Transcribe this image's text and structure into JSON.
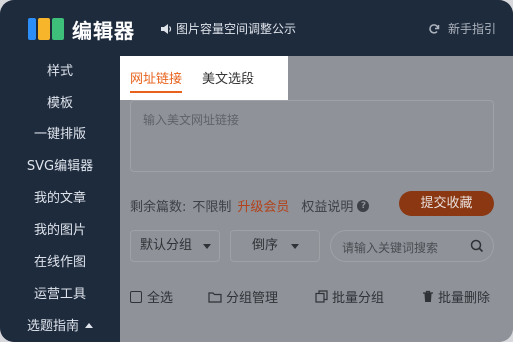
{
  "header": {
    "logo_text": "编辑器",
    "notice": "图片容量空间调整公示",
    "guide": "新手指引"
  },
  "sidebar": {
    "items": [
      {
        "label": "样式"
      },
      {
        "label": "模板"
      },
      {
        "label": "一键排版"
      },
      {
        "label": "SVG编辑器"
      },
      {
        "label": "我的文章"
      },
      {
        "label": "我的图片"
      },
      {
        "label": "在线作图"
      },
      {
        "label": "运营工具"
      },
      {
        "label": "选题指南"
      }
    ]
  },
  "tabs": {
    "url_link": "网址链接",
    "rich_segment": "美文选段"
  },
  "url_input": {
    "placeholder": "输入美文网址链接"
  },
  "quota": {
    "remaining_label": "剩余篇数:",
    "remaining_value": "不限制",
    "upgrade": "升级会员",
    "rights": "权益说明",
    "submit": "提交收藏"
  },
  "filters": {
    "group": "默认分组",
    "order": "倒序",
    "search_placeholder": "请输入关键词搜索"
  },
  "actions": {
    "select_all": "全选",
    "group_manage": "分组管理",
    "batch_group": "批量分组",
    "batch_delete": "批量删除"
  },
  "colors": {
    "accent": "#e8621c",
    "sidebar": "#1e2b3d",
    "submit": "#8a3712"
  }
}
